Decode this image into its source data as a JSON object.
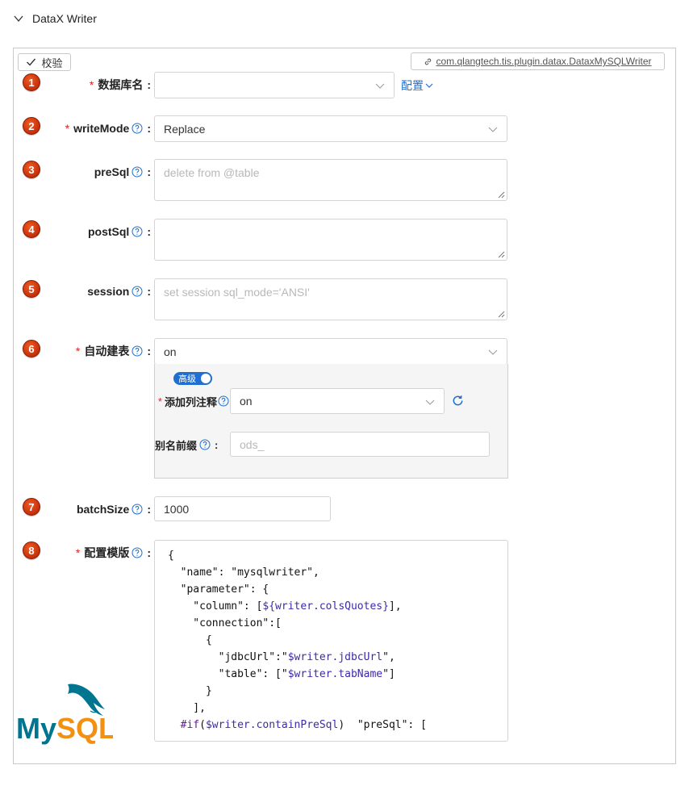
{
  "header": {
    "title": "DataX Writer"
  },
  "toolbar": {
    "verify_label": "校验",
    "plugin_class": "com.qlangtech.tis.plugin.datax.DataxMySQLWriter"
  },
  "fields": [
    {
      "num": "1",
      "label": "数据库名",
      "required": "*",
      "value": "",
      "config_link": "配置"
    },
    {
      "num": "2",
      "label": "writeMode",
      "required": "*",
      "value": "Replace"
    },
    {
      "num": "3",
      "label": "preSql",
      "placeholder": "delete from @table"
    },
    {
      "num": "4",
      "label": "postSql",
      "value": ""
    },
    {
      "num": "5",
      "label": "session",
      "placeholder": "set session sql_mode='ANSI'"
    },
    {
      "num": "6",
      "label": "自动建表",
      "required": "*",
      "value": "on"
    },
    {
      "num": "7",
      "label": "batchSize",
      "value": "1000"
    },
    {
      "num": "8",
      "label": "配置模版",
      "required": "*"
    }
  ],
  "advanced": {
    "toggle_label": "高级",
    "toggle_on": true,
    "comment_label": "添加列注释",
    "comment_required": "*",
    "comment_value": "on",
    "alias_label": "别名前缀",
    "alias_placeholder": "ods_"
  },
  "colon": ":",
  "template_lines": [
    "{",
    "  \"name\": \"mysqlwriter\",",
    "  \"parameter\": {",
    "    \"column\": [${writer.colsQuotes}],",
    "    \"connection\":[",
    "      {",
    "        \"jdbcUrl\":\"$writer.jdbcUrl\",",
    "        \"table\": [\"$writer.tabName\"]",
    "      }",
    "    ],",
    "  #if($writer.containPreSql)  \"preSql\": ["
  ],
  "logo": {
    "text": "MySQL",
    "brand_color": "#00758f",
    "accent_color": "#f29111"
  },
  "colors": {
    "link": "#1f6fd1",
    "badge": "#c62f0a",
    "required": "#e02020"
  }
}
